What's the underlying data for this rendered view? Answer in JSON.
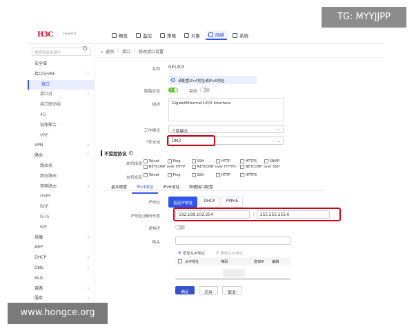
{
  "brand": {
    "logo": "H3C",
    "sub": "Choices 6"
  },
  "nav": [
    {
      "label": "概览",
      "icon": "overview-icon"
    },
    {
      "label": "监控",
      "icon": "monitor-icon"
    },
    {
      "label": "策略",
      "icon": "policy-icon"
    },
    {
      "label": "对象",
      "icon": "object-icon"
    },
    {
      "label": "网络",
      "icon": "network-icon",
      "active": true
    },
    {
      "label": "系统",
      "icon": "system-icon"
    }
  ],
  "sidebar": {
    "search_placeholder": "搜索菜单关键字",
    "items": [
      {
        "label": "安全域",
        "level": 0
      },
      {
        "label": "接口与VRF",
        "level": 0,
        "chevron": "˅"
      },
      {
        "label": "接口",
        "level": 1,
        "active": true
      },
      {
        "label": "接口对",
        "level": 1,
        "chevron": "›"
      },
      {
        "label": "接口联动组",
        "level": 1
      },
      {
        "label": "4G",
        "level": 1
      },
      {
        "label": "链路聚合",
        "level": 1
      },
      {
        "label": "VRF",
        "level": 1
      },
      {
        "label": "VPN",
        "level": 0,
        "chevron": "›"
      },
      {
        "label": "路由",
        "level": 0,
        "chevron": "˅"
      },
      {
        "label": "路由表",
        "level": 1
      },
      {
        "label": "静态路由",
        "level": 1
      },
      {
        "label": "策略路由",
        "level": 1,
        "chevron": "›"
      },
      {
        "label": "OSPF",
        "level": 1
      },
      {
        "label": "BGP",
        "level": 1
      },
      {
        "label": "IS-IS",
        "level": 1
      },
      {
        "label": "RIP",
        "level": 1
      },
      {
        "label": "组播",
        "level": 0,
        "chevron": "›"
      },
      {
        "label": "ARP",
        "level": 0
      },
      {
        "label": "DHCP",
        "level": 0,
        "chevron": "›"
      },
      {
        "label": "DNS",
        "level": 0,
        "chevron": "›"
      },
      {
        "label": "ALG",
        "level": 0
      },
      {
        "label": "链路",
        "level": 0,
        "chevron": "›"
      },
      {
        "label": "服务",
        "level": 0,
        "chevron": "›"
      }
    ]
  },
  "breadcrumb": {
    "back": "← 返回",
    "sep": "|",
    "level1": "接口",
    "slash": "/",
    "current": "修改接口设置"
  },
  "form": {
    "name_label": "名称",
    "name_value": "GE1/0/3",
    "info_text": "请配置IPv4地址或IPv6地址",
    "link_state_label": "链路状态",
    "link_on": "开",
    "disable_label": "禁用",
    "desc_label": "描述",
    "desc_value": "GigabitEthernet1/0/3 Interface",
    "mode_label": "工作模式",
    "mode_value": "三层模式",
    "zone_label": "*安全域",
    "zone_value": "DMZ",
    "unrestricted_title": "不受控协议",
    "local_recv_label": "本机接收",
    "local_send_label": "本机发起",
    "recv_protocols": [
      "Telnet",
      "Ping",
      "SSH",
      "HTTP",
      "HTTPS",
      "SNMP",
      "NETCONF over HTTP",
      "NETCONF over HTTPS",
      "NETCONF over SSH"
    ],
    "send_protocols": [
      "Telnet",
      "Ping",
      "SSH",
      "HTTP",
      "HTTPS"
    ],
    "tabs": [
      "基本配置",
      "IPv4地址",
      "IPv6地址",
      "物理接口配置"
    ],
    "ip_mode_label": "IP地址",
    "ip_modes": [
      "指定IP地址",
      "DHCP",
      "PPPoE"
    ],
    "ip_mask_label": "IP地址/掩码长度",
    "ip_value": "192.168.102.254",
    "mask_sep": "/",
    "mask_value": "255.255.255.0",
    "virtual_ip_label": "虚拟IP",
    "gateway_label": "网关",
    "add_secondary": "添加从IP地址",
    "delete_secondary": "删除从IP地址",
    "table_headers": [
      "从IP地址",
      "掩码",
      "虚拟IP",
      "编辑"
    ],
    "buttons": {
      "ok": "确定",
      "apply": "应用",
      "cancel": "取消"
    }
  },
  "overlays": {
    "top_right": "TG: MYYJJPP",
    "bottom_left": "www.hongce.org"
  },
  "colors": {
    "accent": "#2f54eb",
    "toggle_on": "#52c41a",
    "highlight": "#d0021b",
    "brand": "#c8102e"
  }
}
